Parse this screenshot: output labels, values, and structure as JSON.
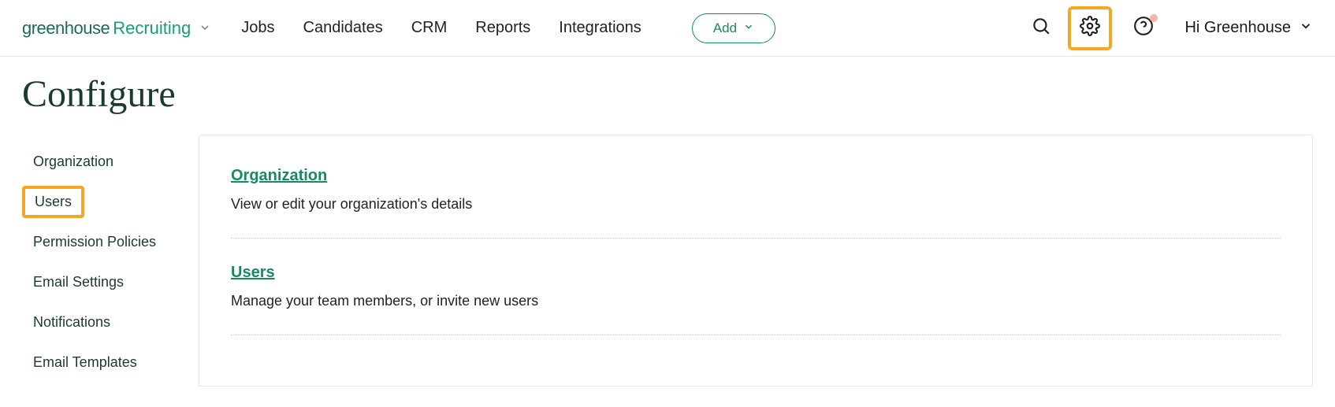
{
  "logo": {
    "primary": "greenhouse",
    "secondary": "Recruiting"
  },
  "nav": {
    "items": [
      "Jobs",
      "Candidates",
      "CRM",
      "Reports",
      "Integrations"
    ],
    "add_label": "Add"
  },
  "user": {
    "greeting": "Hi Greenhouse"
  },
  "page": {
    "title": "Configure"
  },
  "sidebar": {
    "items": [
      {
        "label": "Organization",
        "highlighted": false
      },
      {
        "label": "Users",
        "highlighted": true
      },
      {
        "label": "Permission Policies",
        "highlighted": false
      },
      {
        "label": "Email Settings",
        "highlighted": false
      },
      {
        "label": "Notifications",
        "highlighted": false
      },
      {
        "label": "Email Templates",
        "highlighted": false
      }
    ]
  },
  "sections": [
    {
      "title": "Organization",
      "desc": "View or edit your organization's details"
    },
    {
      "title": "Users",
      "desc": "Manage your team members, or invite new users"
    }
  ]
}
